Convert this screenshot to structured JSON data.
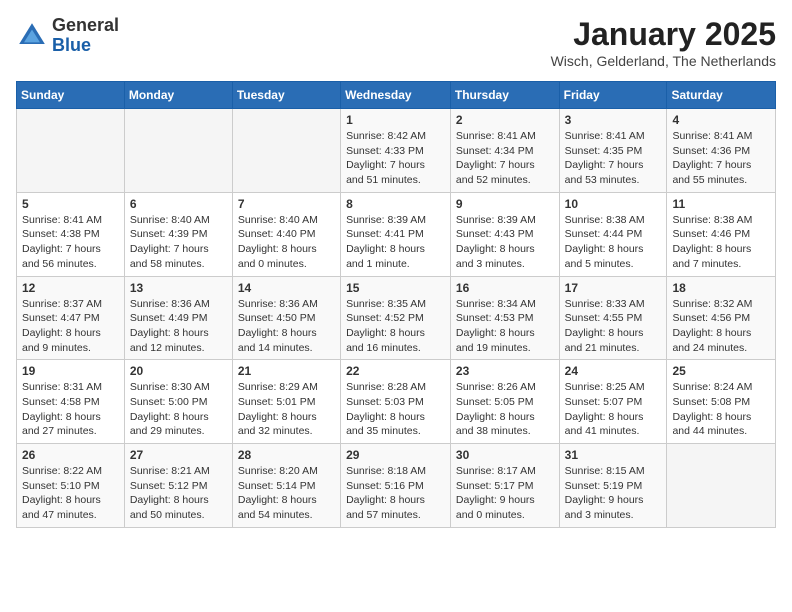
{
  "header": {
    "logo_general": "General",
    "logo_blue": "Blue",
    "month_title": "January 2025",
    "subtitle": "Wisch, Gelderland, The Netherlands"
  },
  "weekdays": [
    "Sunday",
    "Monday",
    "Tuesday",
    "Wednesday",
    "Thursday",
    "Friday",
    "Saturday"
  ],
  "weeks": [
    [
      {
        "day": "",
        "info": ""
      },
      {
        "day": "",
        "info": ""
      },
      {
        "day": "",
        "info": ""
      },
      {
        "day": "1",
        "info": "Sunrise: 8:42 AM\nSunset: 4:33 PM\nDaylight: 7 hours\nand 51 minutes."
      },
      {
        "day": "2",
        "info": "Sunrise: 8:41 AM\nSunset: 4:34 PM\nDaylight: 7 hours\nand 52 minutes."
      },
      {
        "day": "3",
        "info": "Sunrise: 8:41 AM\nSunset: 4:35 PM\nDaylight: 7 hours\nand 53 minutes."
      },
      {
        "day": "4",
        "info": "Sunrise: 8:41 AM\nSunset: 4:36 PM\nDaylight: 7 hours\nand 55 minutes."
      }
    ],
    [
      {
        "day": "5",
        "info": "Sunrise: 8:41 AM\nSunset: 4:38 PM\nDaylight: 7 hours\nand 56 minutes."
      },
      {
        "day": "6",
        "info": "Sunrise: 8:40 AM\nSunset: 4:39 PM\nDaylight: 7 hours\nand 58 minutes."
      },
      {
        "day": "7",
        "info": "Sunrise: 8:40 AM\nSunset: 4:40 PM\nDaylight: 8 hours\nand 0 minutes."
      },
      {
        "day": "8",
        "info": "Sunrise: 8:39 AM\nSunset: 4:41 PM\nDaylight: 8 hours\nand 1 minute."
      },
      {
        "day": "9",
        "info": "Sunrise: 8:39 AM\nSunset: 4:43 PM\nDaylight: 8 hours\nand 3 minutes."
      },
      {
        "day": "10",
        "info": "Sunrise: 8:38 AM\nSunset: 4:44 PM\nDaylight: 8 hours\nand 5 minutes."
      },
      {
        "day": "11",
        "info": "Sunrise: 8:38 AM\nSunset: 4:46 PM\nDaylight: 8 hours\nand 7 minutes."
      }
    ],
    [
      {
        "day": "12",
        "info": "Sunrise: 8:37 AM\nSunset: 4:47 PM\nDaylight: 8 hours\nand 9 minutes."
      },
      {
        "day": "13",
        "info": "Sunrise: 8:36 AM\nSunset: 4:49 PM\nDaylight: 8 hours\nand 12 minutes."
      },
      {
        "day": "14",
        "info": "Sunrise: 8:36 AM\nSunset: 4:50 PM\nDaylight: 8 hours\nand 14 minutes."
      },
      {
        "day": "15",
        "info": "Sunrise: 8:35 AM\nSunset: 4:52 PM\nDaylight: 8 hours\nand 16 minutes."
      },
      {
        "day": "16",
        "info": "Sunrise: 8:34 AM\nSunset: 4:53 PM\nDaylight: 8 hours\nand 19 minutes."
      },
      {
        "day": "17",
        "info": "Sunrise: 8:33 AM\nSunset: 4:55 PM\nDaylight: 8 hours\nand 21 minutes."
      },
      {
        "day": "18",
        "info": "Sunrise: 8:32 AM\nSunset: 4:56 PM\nDaylight: 8 hours\nand 24 minutes."
      }
    ],
    [
      {
        "day": "19",
        "info": "Sunrise: 8:31 AM\nSunset: 4:58 PM\nDaylight: 8 hours\nand 27 minutes."
      },
      {
        "day": "20",
        "info": "Sunrise: 8:30 AM\nSunset: 5:00 PM\nDaylight: 8 hours\nand 29 minutes."
      },
      {
        "day": "21",
        "info": "Sunrise: 8:29 AM\nSunset: 5:01 PM\nDaylight: 8 hours\nand 32 minutes."
      },
      {
        "day": "22",
        "info": "Sunrise: 8:28 AM\nSunset: 5:03 PM\nDaylight: 8 hours\nand 35 minutes."
      },
      {
        "day": "23",
        "info": "Sunrise: 8:26 AM\nSunset: 5:05 PM\nDaylight: 8 hours\nand 38 minutes."
      },
      {
        "day": "24",
        "info": "Sunrise: 8:25 AM\nSunset: 5:07 PM\nDaylight: 8 hours\nand 41 minutes."
      },
      {
        "day": "25",
        "info": "Sunrise: 8:24 AM\nSunset: 5:08 PM\nDaylight: 8 hours\nand 44 minutes."
      }
    ],
    [
      {
        "day": "26",
        "info": "Sunrise: 8:22 AM\nSunset: 5:10 PM\nDaylight: 8 hours\nand 47 minutes."
      },
      {
        "day": "27",
        "info": "Sunrise: 8:21 AM\nSunset: 5:12 PM\nDaylight: 8 hours\nand 50 minutes."
      },
      {
        "day": "28",
        "info": "Sunrise: 8:20 AM\nSunset: 5:14 PM\nDaylight: 8 hours\nand 54 minutes."
      },
      {
        "day": "29",
        "info": "Sunrise: 8:18 AM\nSunset: 5:16 PM\nDaylight: 8 hours\nand 57 minutes."
      },
      {
        "day": "30",
        "info": "Sunrise: 8:17 AM\nSunset: 5:17 PM\nDaylight: 9 hours\nand 0 minutes."
      },
      {
        "day": "31",
        "info": "Sunrise: 8:15 AM\nSunset: 5:19 PM\nDaylight: 9 hours\nand 3 minutes."
      },
      {
        "day": "",
        "info": ""
      }
    ]
  ]
}
